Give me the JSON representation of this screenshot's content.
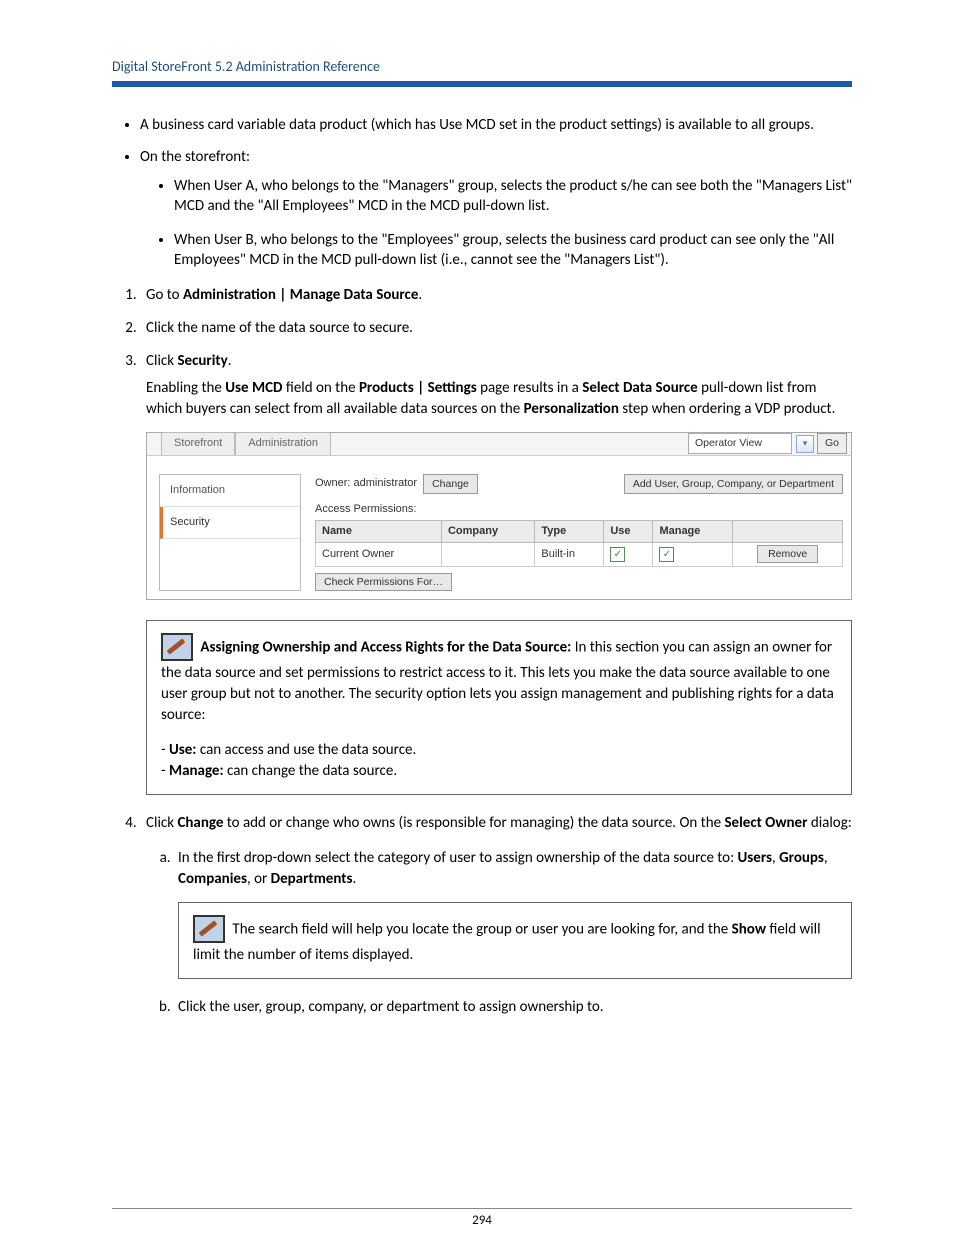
{
  "header": {
    "title": "Digital StoreFront 5.2 Administration Reference"
  },
  "bullets": {
    "b1": "A business card variable data product (which has Use MCD set in the product settings) is available to all groups.",
    "b2": "On the storefront:",
    "sub1": "When User A, who belongs to the \"Managers\" group, selects the product s/he can see both the \"Managers List\" MCD and the \"All Employees\" MCD in the MCD pull-down list.",
    "sub2": "When User B, who belongs to the \"Employees\" group, selects the business card product can see only the \"All Employees\" MCD in the MCD pull-down list (i.e., cannot see the \"Managers List\")."
  },
  "steps": {
    "s1_pre": "Go to ",
    "s1_bold": "Administration | Manage Data Source",
    "s1_post": ".",
    "s2": "Click the name of the data source to secure.",
    "s3_pre": "Click ",
    "s3_bold": "Security",
    "s3_post": ".",
    "s3_cont_a": "Enabling the ",
    "s3_cont_b": "Use MCD",
    "s3_cont_c": " field on the ",
    "s3_cont_d": "Products | Settings",
    "s3_cont_e": " page results in a ",
    "s3_cont_f": "Select Data Source",
    "s3_cont_g": " pull-down list from which buyers can select from all available data sources on the ",
    "s3_cont_h": "Personalization",
    "s3_cont_i": " step when ordering a VDP product.",
    "s4_pre": "Click ",
    "s4_bold": "Change",
    "s4_mid": " to add or change who owns (is responsible for managing) the data source. On the ",
    "s4_bold2": "Select Owner",
    "s4_post": " dialog:",
    "s4a_pre": "In the first drop-down select the category of user to assign ownership of the data source to: ",
    "s4a_b1": "Users",
    "s4a_c1": ", ",
    "s4a_b2": "Groups",
    "s4a_c2": ", ",
    "s4a_b3": "Companies",
    "s4a_c3": ", or ",
    "s4a_b4": "Departments",
    "s4a_post": ".",
    "s4b": "Click the user, group, company, or department to assign ownership to."
  },
  "ui": {
    "tab_storefront": "Storefront",
    "tab_admin": "Administration",
    "operator_view": "Operator View",
    "go": "Go",
    "side_info": "Information",
    "side_security": "Security",
    "owner_label": "Owner: administrator",
    "change_btn": "Change",
    "add_btn": "Add User, Group, Company, or Department",
    "ap_label": "Access Permissions:",
    "th_name": "Name",
    "th_company": "Company",
    "th_type": "Type",
    "th_use": "Use",
    "th_manage": "Manage",
    "row_name": "Current Owner",
    "row_type": "Built-in",
    "remove_btn": "Remove",
    "check_perm_btn": "Check Permissions For…",
    "check": "✓"
  },
  "note1": {
    "lead_bold": "Assigning Ownership and Access Rights for the Data Source:",
    "lead_rest": " In this section you can assign an owner for the data source and set permissions to restrict access to it. This lets you make the data source available to one user group but not to another. The security option lets you assign management and publishing rights for a data source:",
    "use_pre": "- ",
    "use_b": "Use:",
    "use_post": " can access and use the data source.",
    "manage_pre": "- ",
    "manage_b": "Manage:",
    "manage_post": " can change the data source."
  },
  "note2": {
    "text_a": "The search field will help you locate the group or user you are looking for, and the ",
    "text_b": "Show",
    "text_c": " field will limit the number of items displayed."
  },
  "footer": {
    "page_number": "294"
  }
}
